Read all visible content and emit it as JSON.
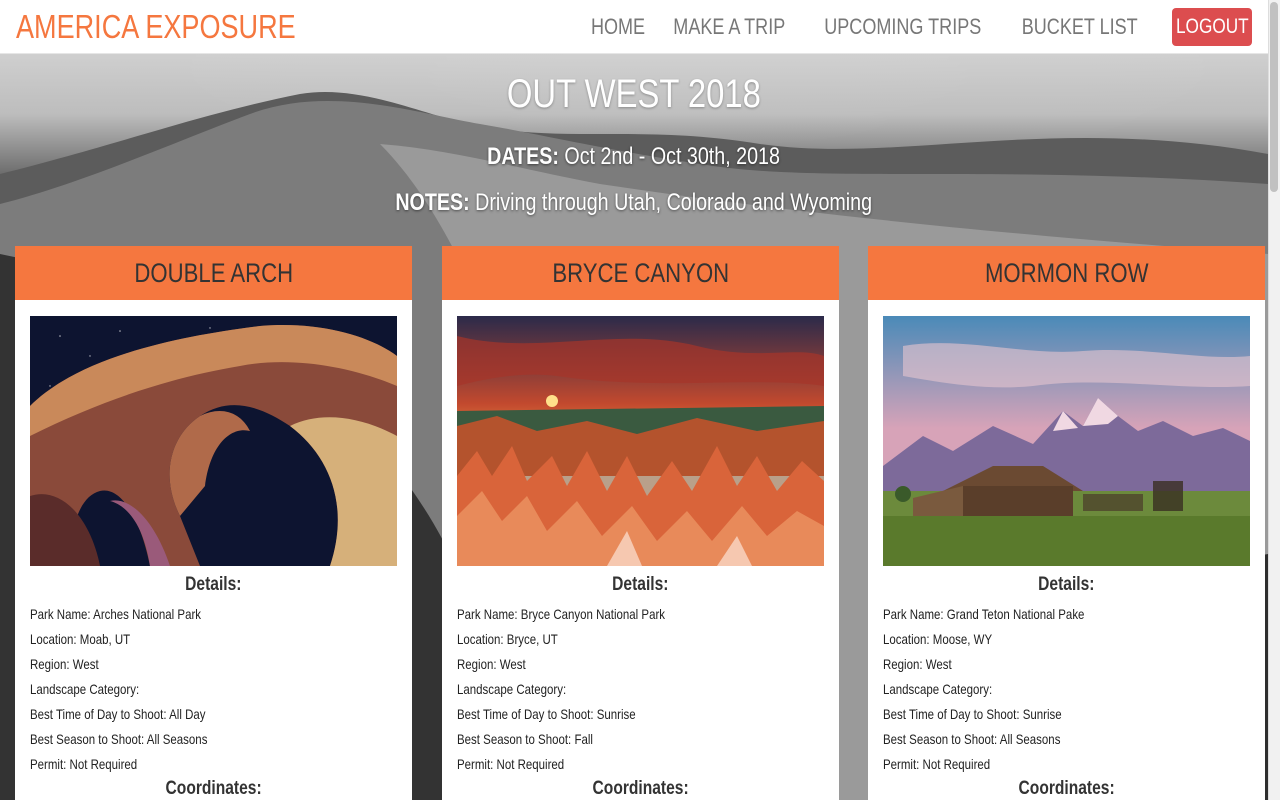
{
  "navbar": {
    "brand": "AMERICA EXPOSURE",
    "links": [
      "HOME",
      "MAKE A TRIP",
      "UPCOMING TRIPS",
      "BUCKET LIST"
    ],
    "logout": "LOGOUT"
  },
  "trip": {
    "title": "OUT WEST 2018",
    "dates_label": "DATES:",
    "dates_value": "Oct 2nd - Oct 30th, 2018",
    "notes_label": "NOTES:",
    "notes_value": "Driving through Utah, Colorado and Wyoming"
  },
  "labels": {
    "details": "Details:",
    "coordinates": "Coordinates:",
    "park_name": "Park Name:",
    "location": "Location:",
    "region": "Region:",
    "landscape": "Landscape Category:",
    "best_time": "Best Time of Day to Shoot:",
    "best_season": "Best Season to Shoot:",
    "permit": "Permit:"
  },
  "cards": [
    {
      "title": "DOUBLE ARCH",
      "park_name": "Arches National Park",
      "location": "Moab, UT",
      "region": "West",
      "landscape": "",
      "best_time": "All Day",
      "best_season": "All Seasons",
      "permit": "Not Required"
    },
    {
      "title": "BRYCE CANYON",
      "park_name": "Bryce Canyon National Park",
      "location": "Bryce, UT",
      "region": "West",
      "landscape": "",
      "best_time": "Sunrise",
      "best_season": "Fall",
      "permit": "Not Required"
    },
    {
      "title": "MORMON ROW",
      "park_name": "Grand Teton National Pake",
      "location": "Moose, WY",
      "region": "West",
      "landscape": "",
      "best_time": "Sunrise",
      "best_season": "All Seasons",
      "permit": "Not Required"
    }
  ],
  "colors": {
    "brand": "#f5773f",
    "logout": "#dc4d4f",
    "card_header": "#f5773f"
  }
}
